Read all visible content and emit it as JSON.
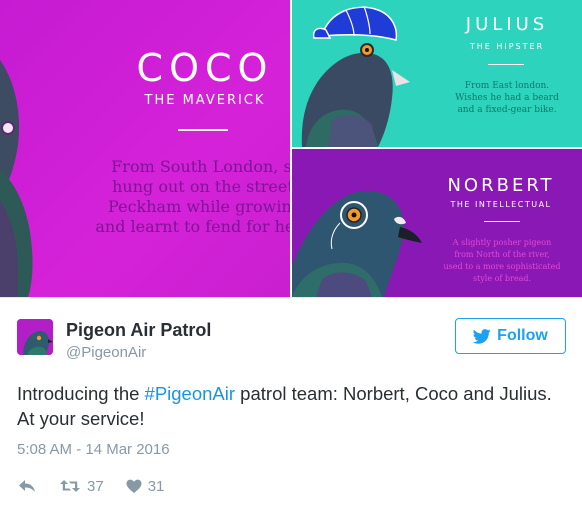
{
  "media": {
    "coco": {
      "name": "COCO",
      "subtitle": "THE MAVERICK",
      "description_lines": [
        "From South London, sh",
        "hung out on the streets",
        "Peckham while growing",
        "and learnt to fend for her"
      ]
    },
    "julius": {
      "name": "JULIUS",
      "subtitle": "THE HIPSTER",
      "description_lines": [
        "From East london.",
        "Wishes he had a beard",
        "and a fixed-gear bike."
      ]
    },
    "norbert": {
      "name": "NORBERT",
      "subtitle": "THE INTELLECTUAL",
      "description_lines": [
        "A slightly posher pigeon",
        "from North of the river,",
        "used to a more sophisticated",
        "style of bread."
      ]
    }
  },
  "tweet": {
    "display_name": "Pigeon Air Patrol",
    "handle": "@PigeonAir",
    "follow_label": "Follow",
    "text_before": "Introducing the ",
    "hashtag": "#PigeonAir",
    "text_after": " patrol team: Norbert, Coco and Julius. At your service!",
    "timestamp": "5:08 AM - 14 Mar 2016",
    "retweet_count": "37",
    "like_count": "31"
  },
  "colors": {
    "coco_bg": "#d21ad8",
    "julius_bg": "#2ed3bd",
    "norbert_bg": "#8a18b4",
    "link_blue": "#1da1f2",
    "muted_gray": "#8899a6"
  },
  "icons": [
    "twitter-bird-icon",
    "reply-icon",
    "retweet-icon",
    "heart-icon"
  ]
}
